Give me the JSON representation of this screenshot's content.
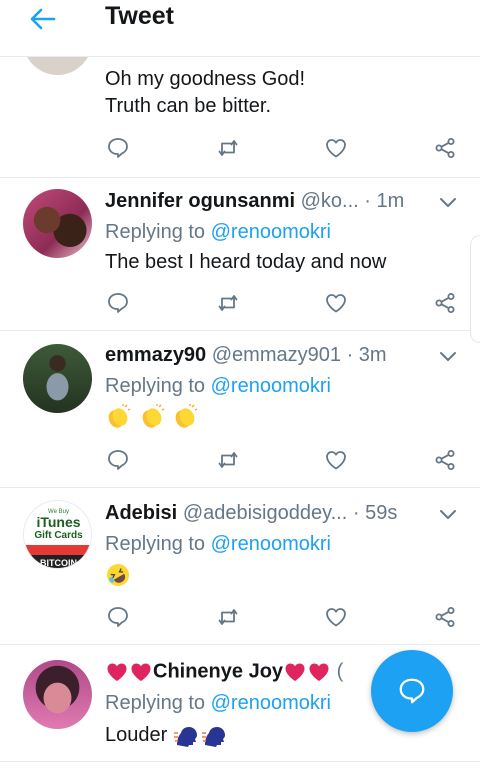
{
  "header": {
    "title": "Tweet",
    "back_icon": "arrow-left-icon"
  },
  "colors": {
    "accent": "#1da1f2",
    "muted": "#657786",
    "text": "#14171a",
    "divider": "#e6ecf0",
    "heart": "#e0245e"
  },
  "tweets": [
    {
      "text_lines": [
        "Oh my goodness God!",
        "Truth can be bitter."
      ]
    },
    {
      "name": "Jennifer ogunsanmi",
      "handle": "@ko...",
      "dot": "·",
      "time": "1m",
      "replying_prefix": "Replying to",
      "replying_to": "@renoomokri",
      "text": "The best I heard today and now"
    },
    {
      "name": "emmazy90",
      "handle": "@emmazy901",
      "dot": "·",
      "time": "3m",
      "replying_prefix": "Replying to",
      "replying_to": "@renoomokri",
      "emojis": [
        "clapping-hands",
        "clapping-hands",
        "clapping-hands"
      ]
    },
    {
      "name": "Adebisi",
      "handle": "@adebisigoddey...",
      "dot": "·",
      "time": "59s",
      "replying_prefix": "Replying to",
      "replying_to": "@renoomokri",
      "emojis": [
        "rolling-on-floor-laughing"
      ],
      "avatar_text": {
        "top": "We Buy",
        "brand": "iTunes",
        "sub": "Gift Cards",
        "bottom": "BITCOIN"
      }
    },
    {
      "name": "Chinenye Joy",
      "handle": "(",
      "replying_prefix": "Replying to",
      "replying_to": "@renoomokri",
      "text": "Louder",
      "emojis": [
        "speaking-head",
        "speaking-head"
      ]
    }
  ]
}
